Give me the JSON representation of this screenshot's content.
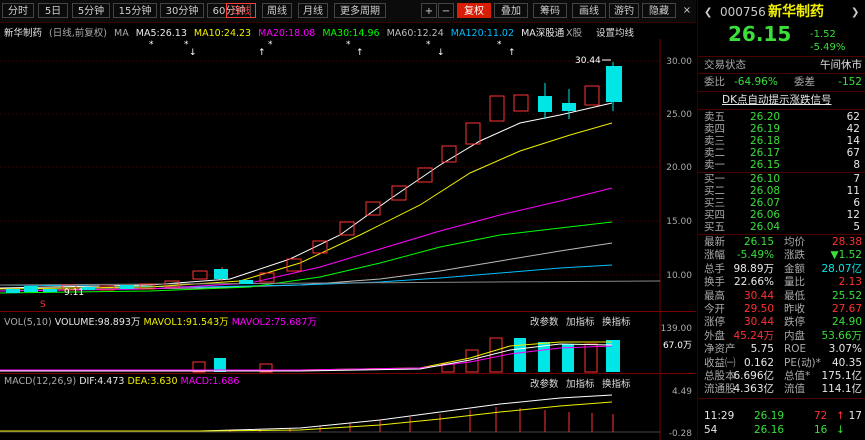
{
  "toolbar": {
    "items": [
      "分时",
      "5日",
      "5分钟",
      "15分钟",
      "30分钟",
      "60分钟",
      "日线",
      "周线",
      "月线",
      "更多周期"
    ],
    "right_items": [
      "+",
      "−",
      "复权",
      "叠加",
      "筹码",
      "画线",
      "游钓",
      "隐藏"
    ],
    "close": "×"
  },
  "main_header": {
    "name": "新华制药",
    "mode": "(日线,前复权)",
    "ma_label": "MA",
    "ma5": "MA5:26.13",
    "ma10": "MA10:24.23",
    "ma20": "MA20:18.08",
    "ma30": "MA30:14.96",
    "ma60": "MA60:12.24",
    "ma120": "MA120:11.02",
    "ma_extra": "MA深股通",
    "x_btn": "X股",
    "settings": "设置均线"
  },
  "price_axis": [
    "30.00",
    "25.00",
    "20.00",
    "15.00",
    "10.00"
  ],
  "price_annotations": {
    "high": "30.44",
    "low": "9.11"
  },
  "vol_header": {
    "label": "VOL(5,10)",
    "volume": "VOLUME:98.893万",
    "mavol1": "MAVOL1:91.543万",
    "mavol2": "MAVOL2:75.687万",
    "btns": [
      "改参数",
      "加指标",
      "换指标"
    ]
  },
  "vol_axis": {
    "top": "139.00",
    "current": "67.0万"
  },
  "macd_header": {
    "label": "MACD(12,26,9)",
    "dif": "DIF:4.473",
    "dea": "DEA:3.630",
    "macd": "MACD:1.686",
    "btns": [
      "改参数",
      "加指标",
      "换指标"
    ]
  },
  "macd_axis": {
    "top": "4.49",
    "bottom": "-0.28"
  },
  "stock": {
    "code": "000756",
    "name": "新华制药",
    "price": "26.15",
    "change": "-1.52",
    "change_pct": "-5.49%",
    "status_label": "交易状态",
    "status": "午间休市",
    "weibi_label": "委比",
    "weibi": "-64.96%",
    "weicha_label": "委差",
    "weicha": "-152",
    "dk_link": "DK点自动提示涨跌信号"
  },
  "asks": [
    {
      "label": "卖五",
      "price": "26.20",
      "vol": "62"
    },
    {
      "label": "卖四",
      "price": "26.19",
      "vol": "42"
    },
    {
      "label": "卖三",
      "price": "26.18",
      "vol": "14"
    },
    {
      "label": "卖二",
      "price": "26.17",
      "vol": "67"
    },
    {
      "label": "卖一",
      "price": "26.15",
      "vol": "8"
    }
  ],
  "bids": [
    {
      "label": "买一",
      "price": "26.10",
      "vol": "7"
    },
    {
      "label": "买二",
      "price": "26.08",
      "vol": "11"
    },
    {
      "label": "买三",
      "price": "26.07",
      "vol": "6"
    },
    {
      "label": "买四",
      "price": "26.06",
      "vol": "12"
    },
    {
      "label": "买五",
      "price": "26.04",
      "vol": "5"
    }
  ],
  "quote": [
    [
      "最新",
      "26.15",
      "均价",
      "28.38"
    ],
    [
      "涨幅",
      "-5.49%",
      "涨跌",
      "▼1.52"
    ],
    [
      "总手",
      "98.89万",
      "金额",
      "28.07亿"
    ],
    [
      "换手",
      "22.66%",
      "量比",
      "2.13"
    ],
    [
      "最高",
      "30.44",
      "最低",
      "25.52"
    ],
    [
      "今开",
      "29.50",
      "昨收",
      "27.67"
    ],
    [
      "涨停",
      "30.44",
      "跌停",
      "24.90"
    ],
    [
      "外盘",
      "45.24万",
      "内盘",
      "53.66万"
    ],
    [
      "净资产",
      "5.75",
      "ROE",
      "3.07%"
    ],
    [
      "收益㈠",
      "0.162",
      "PE(动)*",
      "40.35"
    ],
    [
      "总股本",
      "6.696亿",
      "总值*",
      "175.1亿"
    ],
    [
      "流通股",
      "4.363亿",
      "流值",
      "114.1亿"
    ]
  ],
  "ticks": [
    {
      "time": "11:29",
      "price": "26.19",
      "vol": "72",
      "dir": "↑",
      "vol2": "17"
    },
    {
      "time": "54",
      "price": "26.16",
      "vol": "16",
      "dir": "↓",
      "vol2": ""
    }
  ],
  "colors": {
    "up": "#ff3232",
    "down": "#00e6e6",
    "ma5": "#ffffff",
    "ma10": "#f0f000",
    "ma20": "#ff00ff",
    "ma30": "#00ff00",
    "ma60": "#aaaaaa",
    "ma120": "#00bfff"
  }
}
